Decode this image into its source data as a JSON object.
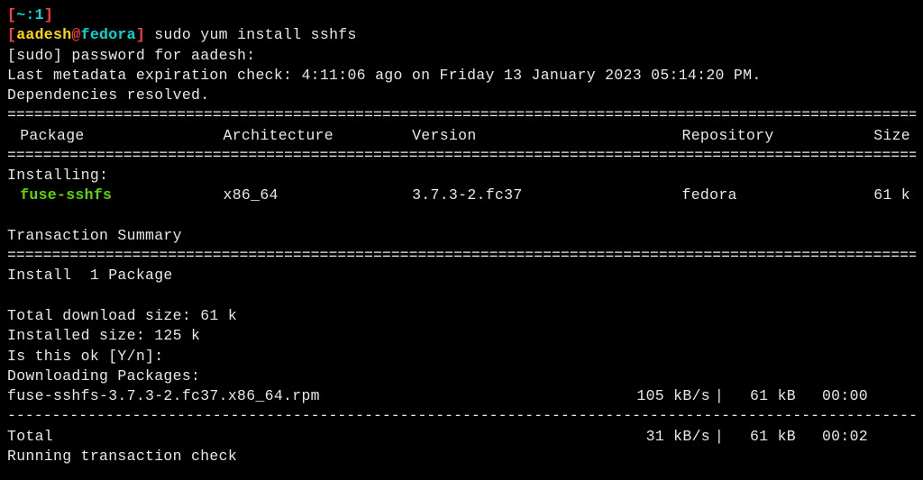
{
  "prompt": {
    "bracket_open": "[",
    "tilde_part": "~:",
    "num_part": "1",
    "bracket_close": "]",
    "user": "aadesh",
    "at": "@",
    "host": "fedora",
    "end_bracket": "]",
    "dollar": " "
  },
  "command": "sudo yum install sshfs",
  "sudo_prompt": "[sudo] password for aadesh:",
  "metadata_line": "Last metadata expiration check: 4:11:06 ago on Friday 13 January 2023 05:14:20 PM.",
  "deps_line": "Dependencies resolved.",
  "headers": {
    "package": " Package",
    "architecture": "Architecture",
    "version": "Version",
    "repository": "Repository",
    "size": "Size"
  },
  "installing_label": "Installing:",
  "package_row": {
    "name": " fuse-sshfs",
    "arch": "x86_64",
    "version": "3.7.3-2.fc37",
    "repo": "fedora",
    "size": "61 k"
  },
  "txn_summary": "Transaction Summary",
  "install_count": "Install  1 Package",
  "download_size": "Total download size: 61 k",
  "installed_size": "Installed size: 125 k",
  "confirm_prompt": "Is this ok [Y/n]:",
  "downloading_label": "Downloading Packages:",
  "download_row": {
    "filename": "fuse-sshfs-3.7.3-2.fc37.x86_64.rpm",
    "speed": "105 kB/s",
    "sep": "|",
    "size": "61 kB",
    "time": "00:00"
  },
  "total_row": {
    "label": "Total",
    "speed": "31 kB/s",
    "sep": "|",
    "size": "61 kB",
    "time": "00:02"
  },
  "running_check": "Running transaction check",
  "divider_double": "================================================================================================================",
  "divider_single": "----------------------------------------------------------------------------------------------------------------"
}
